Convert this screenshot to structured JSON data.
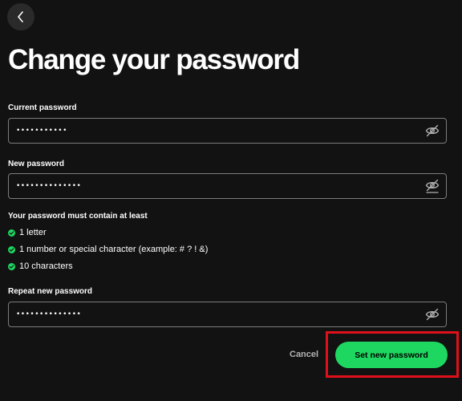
{
  "header": {
    "back_icon": "chevron-left-icon",
    "title": "Change your password"
  },
  "form": {
    "current": {
      "label": "Current password",
      "value": "•••••••••••"
    },
    "new": {
      "label": "New password",
      "value": "••••••••••••••"
    },
    "requirements": {
      "title": "Your password must contain at least",
      "items": [
        "1 letter",
        "1 number or special character (example: # ? ! &)",
        "10 characters"
      ],
      "status_color": "#1ed760"
    },
    "repeat": {
      "label": "Repeat new password",
      "value": "••••••••••••••"
    },
    "toggle_icon": "eye-slash-icon"
  },
  "actions": {
    "cancel_label": "Cancel",
    "submit_label": "Set new password",
    "accent_color": "#1ed760",
    "highlight_color": "#e0101a"
  }
}
